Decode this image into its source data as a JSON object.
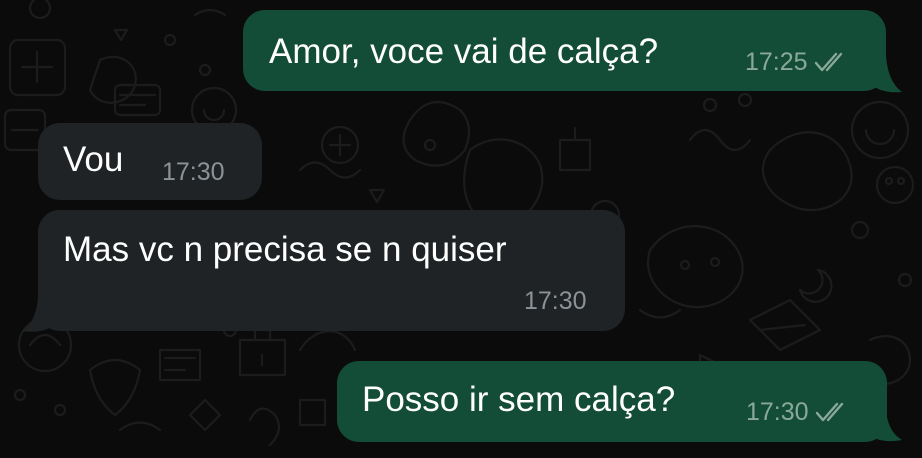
{
  "chat": {
    "messages": [
      {
        "direction": "outgoing",
        "text": "Amor, voce vai de calça?",
        "time": "17:25",
        "status_icon": "double-check-read-icon"
      },
      {
        "direction": "incoming",
        "text": "Vou",
        "time": "17:30"
      },
      {
        "direction": "incoming",
        "text": "Mas vc n precisa se n quiser",
        "time": "17:30"
      },
      {
        "direction": "outgoing",
        "text": "Posso ir sem calça?",
        "time": "17:30",
        "status_icon": "double-check-read-icon"
      }
    ]
  },
  "colors": {
    "background": "#0b0b0b",
    "outgoing_bubble": "#134d37",
    "incoming_bubble": "#1f2325",
    "text": "#ffffff",
    "outgoing_meta": "#8aa99b",
    "incoming_meta": "#8c9295"
  }
}
